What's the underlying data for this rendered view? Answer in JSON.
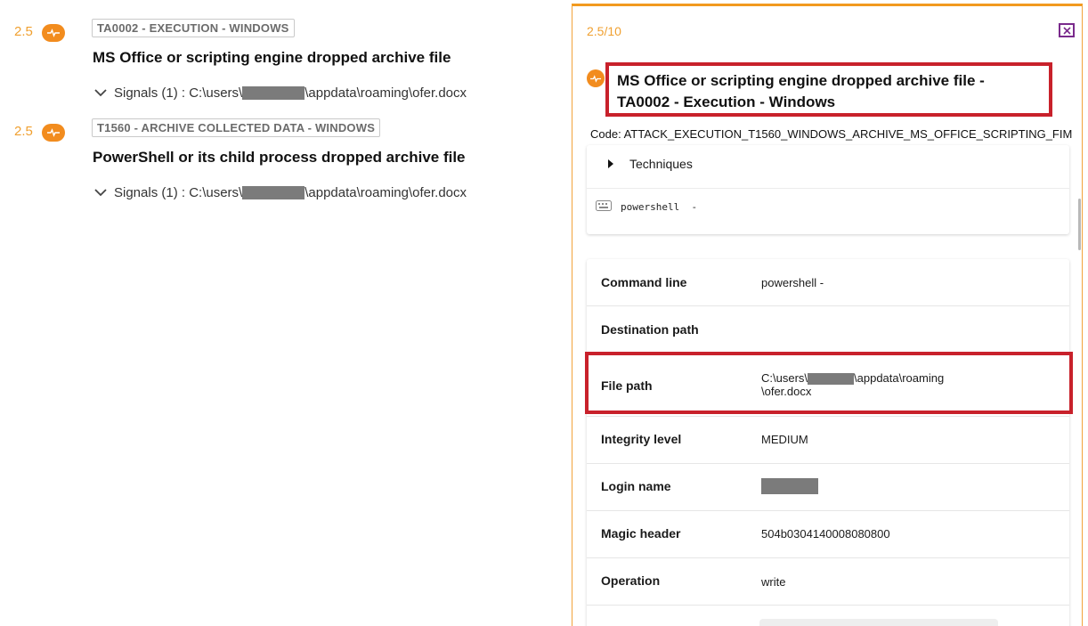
{
  "alerts": [
    {
      "score": "2.5",
      "tag": "TA0002 - EXECUTION - WINDOWS",
      "title": "MS Office or scripting engine dropped archive file",
      "signals_prefix": "Signals (1) : C:\\users\\",
      "signals_suffix": "\\appdata\\roaming\\ofer.docx"
    },
    {
      "score": "2.5",
      "tag": "T1560 - ARCHIVE COLLECTED DATA - WINDOWS",
      "title": "PowerShell or its child process dropped archive file",
      "signals_prefix": "Signals (1) : C:\\users\\",
      "signals_suffix": "\\appdata\\roaming\\ofer.docx"
    }
  ],
  "panel": {
    "score": "2.5/10",
    "title": "MS Office or scripting engine dropped archive file - TA0002 - Execution - Windows",
    "code": "Code: ATTACK_EXECUTION_T1560_WINDOWS_ARCHIVE_MS_OFFICE_SCRIPTING_FIM",
    "techniques_label": "Techniques",
    "command_preview": "powershell  -",
    "details": [
      {
        "label": "Command line",
        "value": "powershell -"
      },
      {
        "label": "Destination path",
        "value": ""
      },
      {
        "label": "File path",
        "value_line1_prefix": "C:\\users\\",
        "value_line1_suffix": "\\appdata\\roaming",
        "value_line2": "\\ofer.docx"
      },
      {
        "label": "Integrity level",
        "value": "MEDIUM"
      },
      {
        "label": "Login name",
        "value": ""
      },
      {
        "label": "Magic header",
        "value": "504b0304140008080800"
      },
      {
        "label": "Operation",
        "value": "write"
      }
    ]
  },
  "colors": {
    "accent_orange": "#f28c1e",
    "highlight_red": "#c8212b",
    "close_purple": "#7a2a8c"
  },
  "icons": {
    "severity": "pulse-icon",
    "close": "close-icon",
    "expand": "chevron-down-icon",
    "techniques_toggle": "caret-right-icon",
    "command": "keyboard-icon"
  }
}
